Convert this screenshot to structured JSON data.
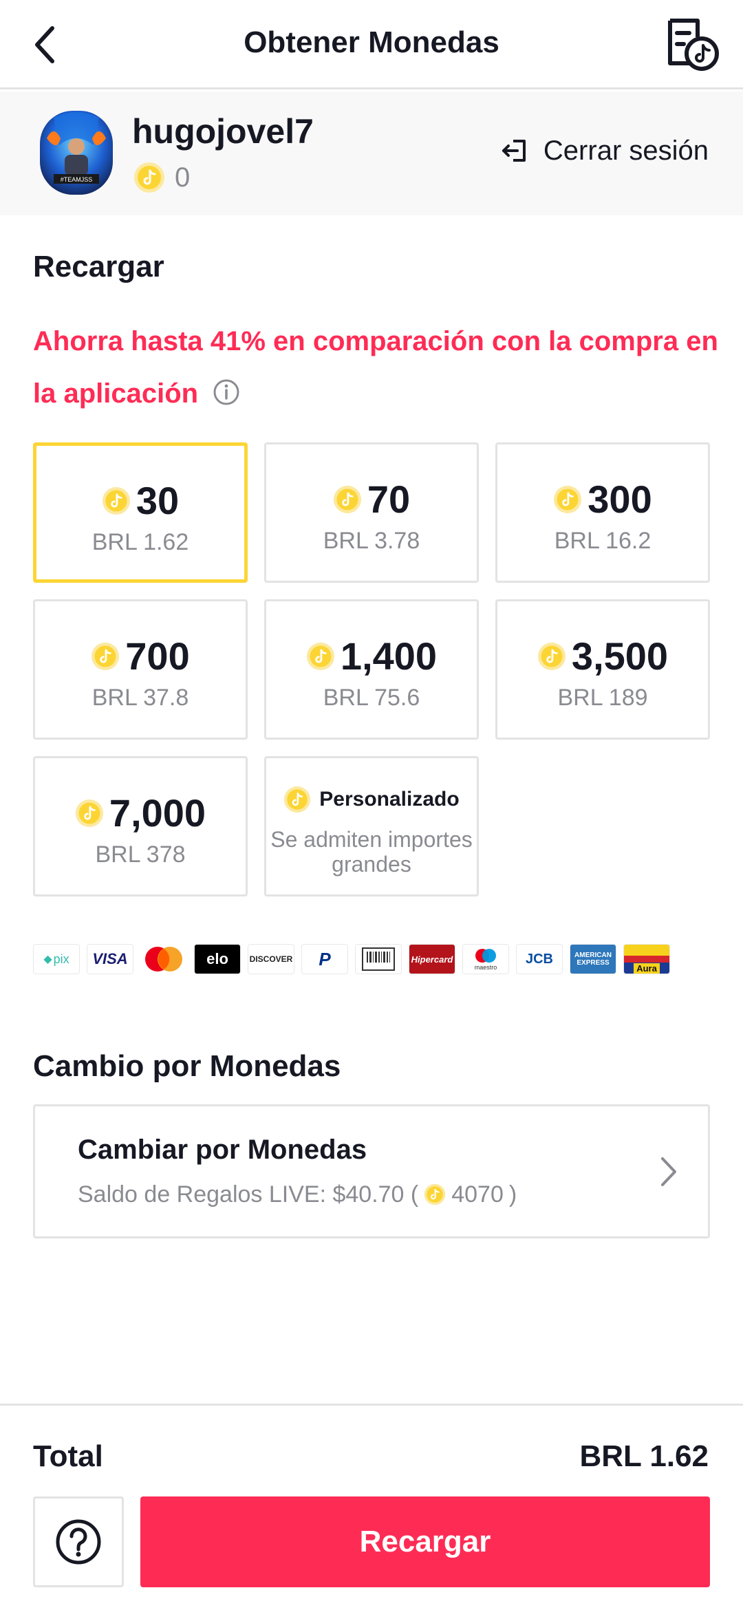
{
  "header": {
    "title": "Obtener Monedas"
  },
  "profile": {
    "username": "hugojovel7",
    "coin_balance": "0",
    "logout_label": "Cerrar sesión",
    "avatar_caption": "#TEAMJSS"
  },
  "recharge": {
    "section_title": "Recargar",
    "promo_text": "Ahorra hasta 41% en comparación con la compra en la aplicación",
    "packages": [
      {
        "coins": "30",
        "price": "BRL 1.62",
        "selected": true
      },
      {
        "coins": "70",
        "price": "BRL 3.78",
        "selected": false
      },
      {
        "coins": "300",
        "price": "BRL 16.2",
        "selected": false
      },
      {
        "coins": "700",
        "price": "BRL 37.8",
        "selected": false
      },
      {
        "coins": "1,400",
        "price": "BRL 75.6",
        "selected": false
      },
      {
        "coins": "3,500",
        "price": "BRL 189",
        "selected": false
      },
      {
        "coins": "7,000",
        "price": "BRL 378",
        "selected": false
      }
    ],
    "custom": {
      "label": "Personalizado",
      "subtitle": "Se admiten importes grandes"
    }
  },
  "payment_methods": [
    {
      "name": "pix",
      "text": "pix"
    },
    {
      "name": "visa",
      "text": "VISA"
    },
    {
      "name": "mastercard",
      "text": ""
    },
    {
      "name": "elo",
      "text": "elo"
    },
    {
      "name": "discover",
      "text": "DISCOVER"
    },
    {
      "name": "paypal",
      "text": "P"
    },
    {
      "name": "boleto",
      "text": ""
    },
    {
      "name": "hipercard",
      "text": "Hipercard"
    },
    {
      "name": "maestro",
      "text": "maestro"
    },
    {
      "name": "jcb",
      "text": "JCB"
    },
    {
      "name": "amex",
      "text": "AMERICAN EXPRESS"
    },
    {
      "name": "aura",
      "text": "Aura"
    }
  ],
  "exchange": {
    "section_title": "Cambio por Monedas",
    "card_title": "Cambiar por Monedas",
    "balance_prefix": "Saldo de Regalos LIVE: $40.70 (",
    "balance_coins": "4070",
    "balance_suffix": ")"
  },
  "footer": {
    "total_label": "Total",
    "total_value": "BRL 1.62",
    "recharge_button": "Recargar"
  },
  "colors": {
    "accent": "#fe2c55",
    "coin": "#fcd535",
    "selected_border": "#fcd535",
    "muted_text": "#8a8b91"
  }
}
